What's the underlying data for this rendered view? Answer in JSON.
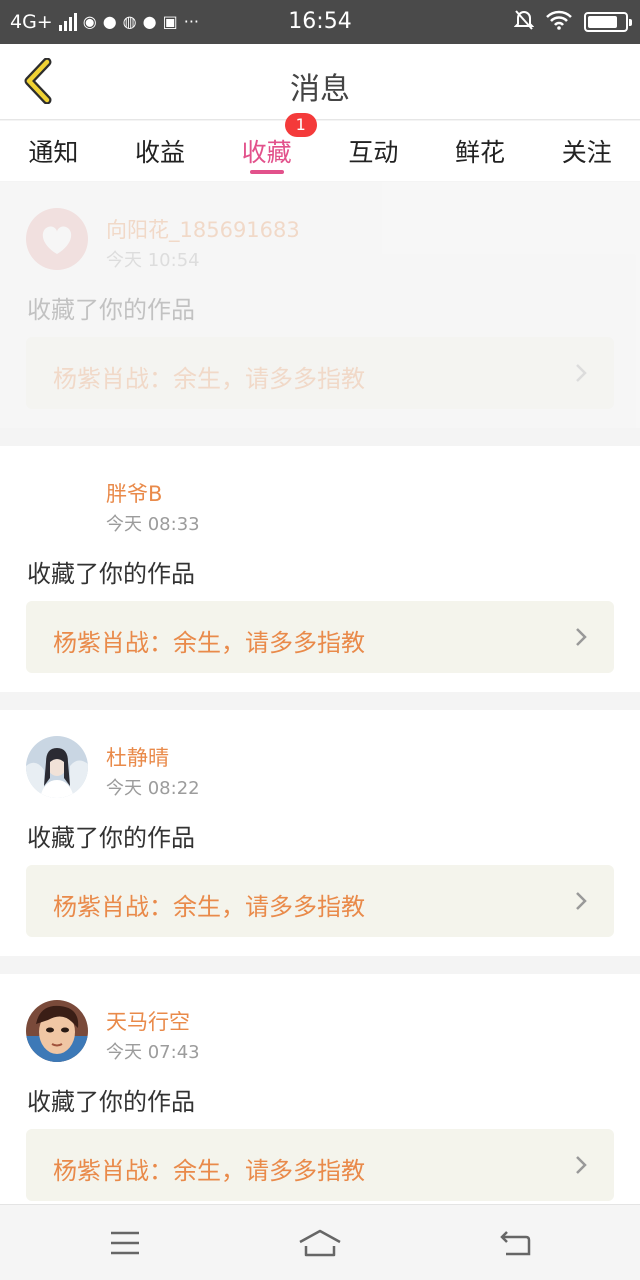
{
  "status_bar": {
    "network": "4G+",
    "time": "16:54",
    "battery_level": 0.8,
    "dots": "···"
  },
  "header": {
    "title": "消息"
  },
  "tabs": [
    {
      "label": "通知"
    },
    {
      "label": "收益"
    },
    {
      "label": "收藏",
      "badge": "1",
      "active": true
    },
    {
      "label": "互动"
    },
    {
      "label": "鲜花"
    },
    {
      "label": "关注"
    }
  ],
  "messages": [
    {
      "username": "向阳花_185691683",
      "time": "今天 10:54",
      "action": "收藏了你的作品",
      "work_title": "杨紫肖战：余生，请多多指教"
    },
    {
      "username": "胖爷B",
      "time": "今天 08:33",
      "action": "收藏了你的作品",
      "work_title": "杨紫肖战：余生，请多多指教"
    },
    {
      "username": "杜静晴",
      "time": "今天 08:22",
      "action": "收藏了你的作品",
      "work_title": "杨紫肖战：余生，请多多指教"
    },
    {
      "username": "天马行空",
      "time": "今天 07:43",
      "action": "收藏了你的作品",
      "work_title": "杨紫肖战：余生，请多多指教"
    }
  ],
  "colors": {
    "accent": "#e2518b",
    "username": "#e98a4a",
    "badge": "#f43a3a",
    "work_bg": "#f4f4ec"
  }
}
